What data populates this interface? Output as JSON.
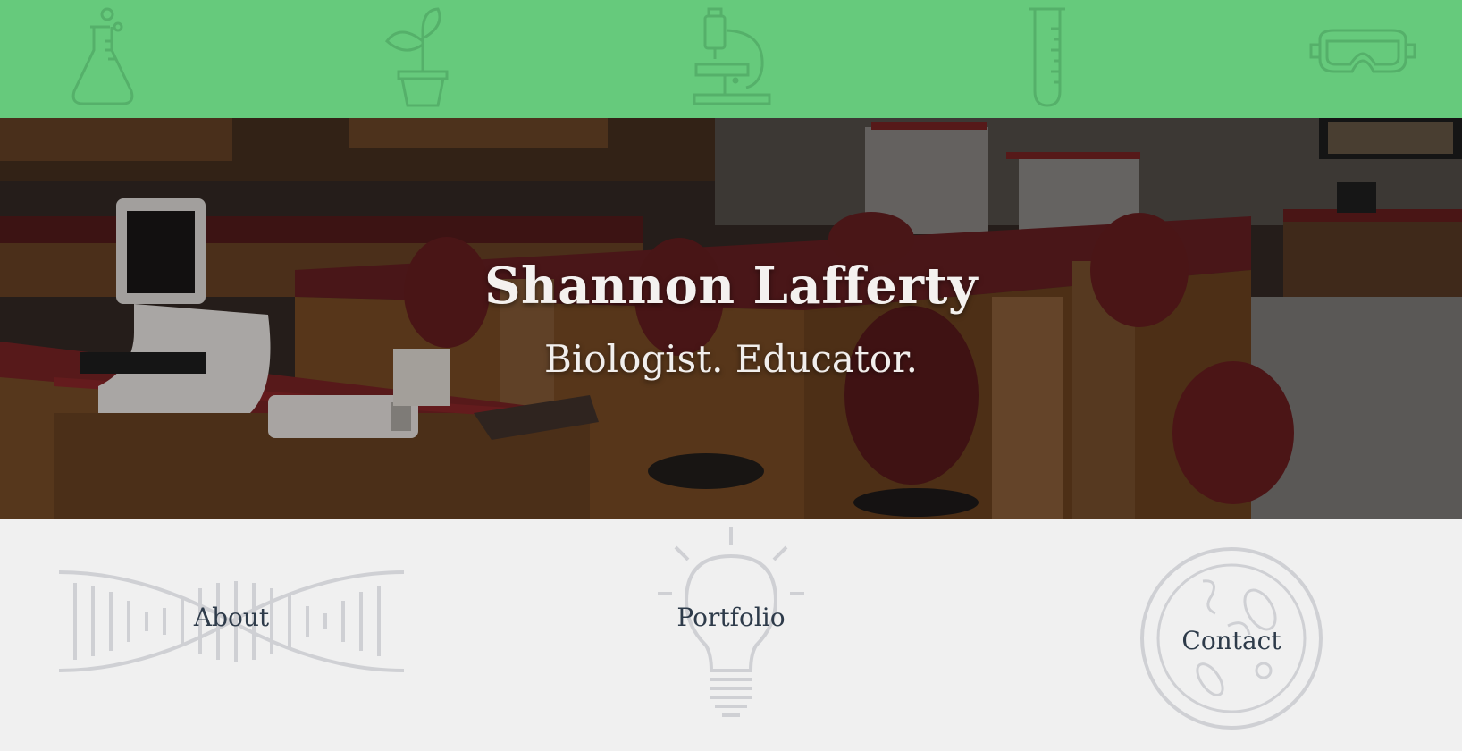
{
  "banner": {
    "color": "#66ca7c",
    "icons": [
      "flask-icon",
      "plant-icon",
      "microscope-icon",
      "test-tube-icon",
      "goggles-icon"
    ]
  },
  "hero": {
    "title": "Shannon Lafferty",
    "subtitle": "Biologist. Educator."
  },
  "nav": {
    "items": [
      {
        "label": "About",
        "icon": "dna-icon"
      },
      {
        "label": "Portfolio",
        "icon": "lightbulb-icon"
      },
      {
        "label": "Contact",
        "icon": "petri-dish-icon"
      }
    ]
  }
}
